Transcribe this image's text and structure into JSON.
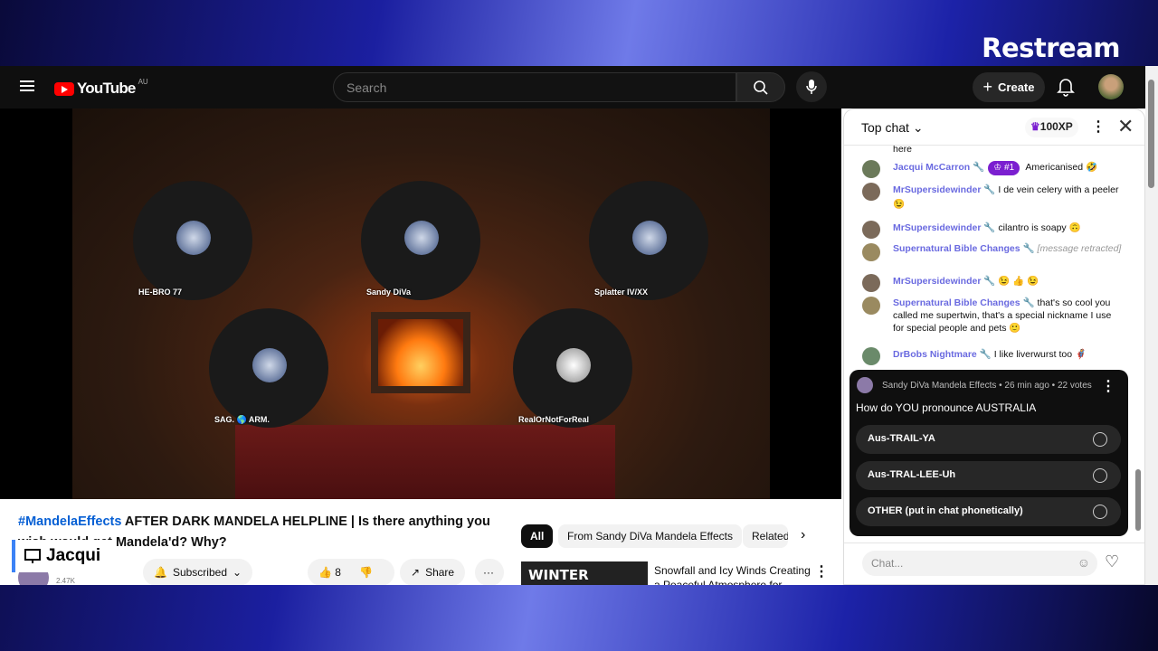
{
  "brand": "Restream",
  "header": {
    "logo": "YouTube",
    "region": "AU",
    "search_placeholder": "Search",
    "create_label": "Create"
  },
  "participants": [
    "HE-BRO 77",
    "Sandy DiVa",
    "Splatter IV/XX",
    "SAG. 🌎 ARM.",
    "RealOrNotForReal"
  ],
  "video": {
    "hashtag": "#MandelaEffects",
    "title": " AFTER DARK MANDELA HELPLINE | Is there anything you wish would get Mandela'd? Why?",
    "overlay_name": "Jacqui",
    "channel_subs": "2.47K",
    "subscribed_label": "Subscribed",
    "likes": "8",
    "share_label": "Share"
  },
  "chips": [
    "All",
    "From Sandy DiVa Mandela Effects",
    "Related"
  ],
  "related": {
    "thumb_text": "WINTER STORM",
    "title": "Snowfall and Icy Winds Creating a Peaceful Atmosphere for"
  },
  "chat": {
    "mode": "Top chat",
    "xp": "100XP",
    "partial_top": "here",
    "messages": [
      {
        "author": "Jacqui McCarron",
        "badge": "#1",
        "text": "Americanised 🤣"
      },
      {
        "author": "MrSupersidewinder",
        "text": "I de vein celery with a peeler 😉"
      },
      {
        "author": "MrSupersidewinder",
        "text": "cilantro is soapy 🙃"
      },
      {
        "author": "Supernatural Bible Changes",
        "text": "[message retracted]"
      },
      {
        "author": "MrSupersidewinder",
        "text": "😉 👍 😉"
      },
      {
        "author": "Supernatural Bible Changes",
        "text": "that's so cool you called me supertwin, that's a special nickname I use for special people and pets 🙂"
      },
      {
        "author": "DrBobs Nightmare",
        "text": "I like liverwurst too 🦸"
      }
    ],
    "poll": {
      "meta": "Sandy DiVa Mandela Effects • 26 min ago • 22 votes",
      "question": "How do YOU pronounce AUSTRALIA",
      "options": [
        "Aus-TRAIL-YA",
        "Aus-TRAL-LEE-Uh",
        "OTHER (put in chat phonetically)"
      ]
    },
    "input_placeholder": "Chat..."
  }
}
